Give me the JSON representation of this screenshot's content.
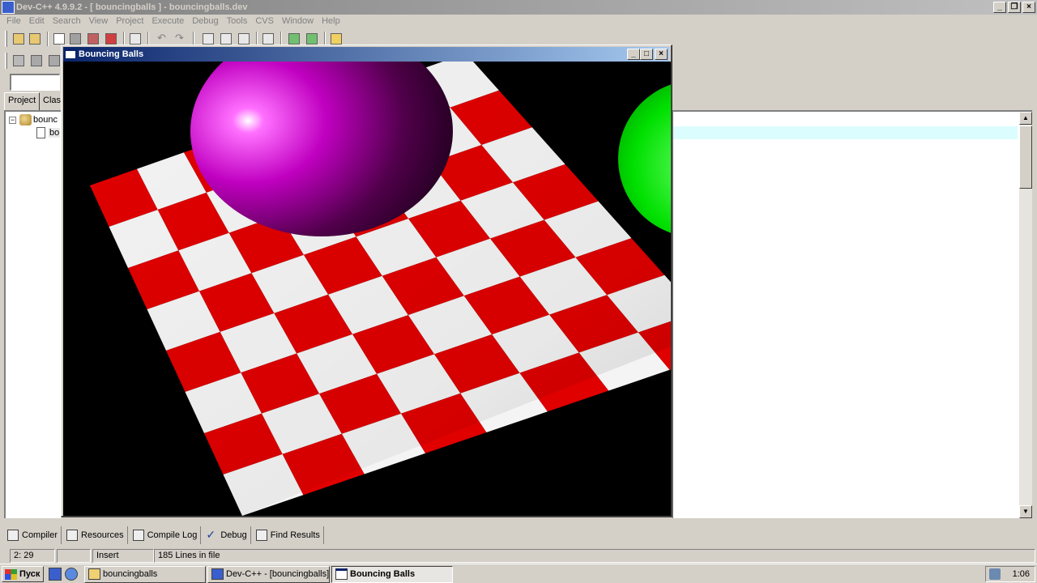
{
  "main_window": {
    "title": "Dev-C++ 4.9.9.2  - [ bouncingballs ] - bouncingballs.dev"
  },
  "menu": [
    "File",
    "Edit",
    "Search",
    "View",
    "Project",
    "Execute",
    "Debug",
    "Tools",
    "CVS",
    "Window",
    "Help"
  ],
  "left_panel": {
    "tabs": [
      "Project",
      "Class"
    ],
    "tree_root": "bounc",
    "tree_child": "bo"
  },
  "bouncing_window": {
    "title": "Bouncing Balls",
    "colors": {
      "checker_red": "#e00000",
      "checker_white": "#f4f4f4",
      "magenta_ball": "#c000c0",
      "green_ball": "#00e000",
      "background": "#000000"
    }
  },
  "output_tabs": [
    "Compiler",
    "Resources",
    "Compile Log",
    "Debug",
    "Find Results"
  ],
  "status": {
    "position": "2: 29",
    "mode": "Insert",
    "lines": "185 Lines in file"
  },
  "taskbar": {
    "start": "Пуск",
    "tasks": [
      "bouncingballs",
      "Dev-C++ - [bouncingballs]",
      "Bouncing Balls"
    ],
    "clock": "1:06"
  }
}
